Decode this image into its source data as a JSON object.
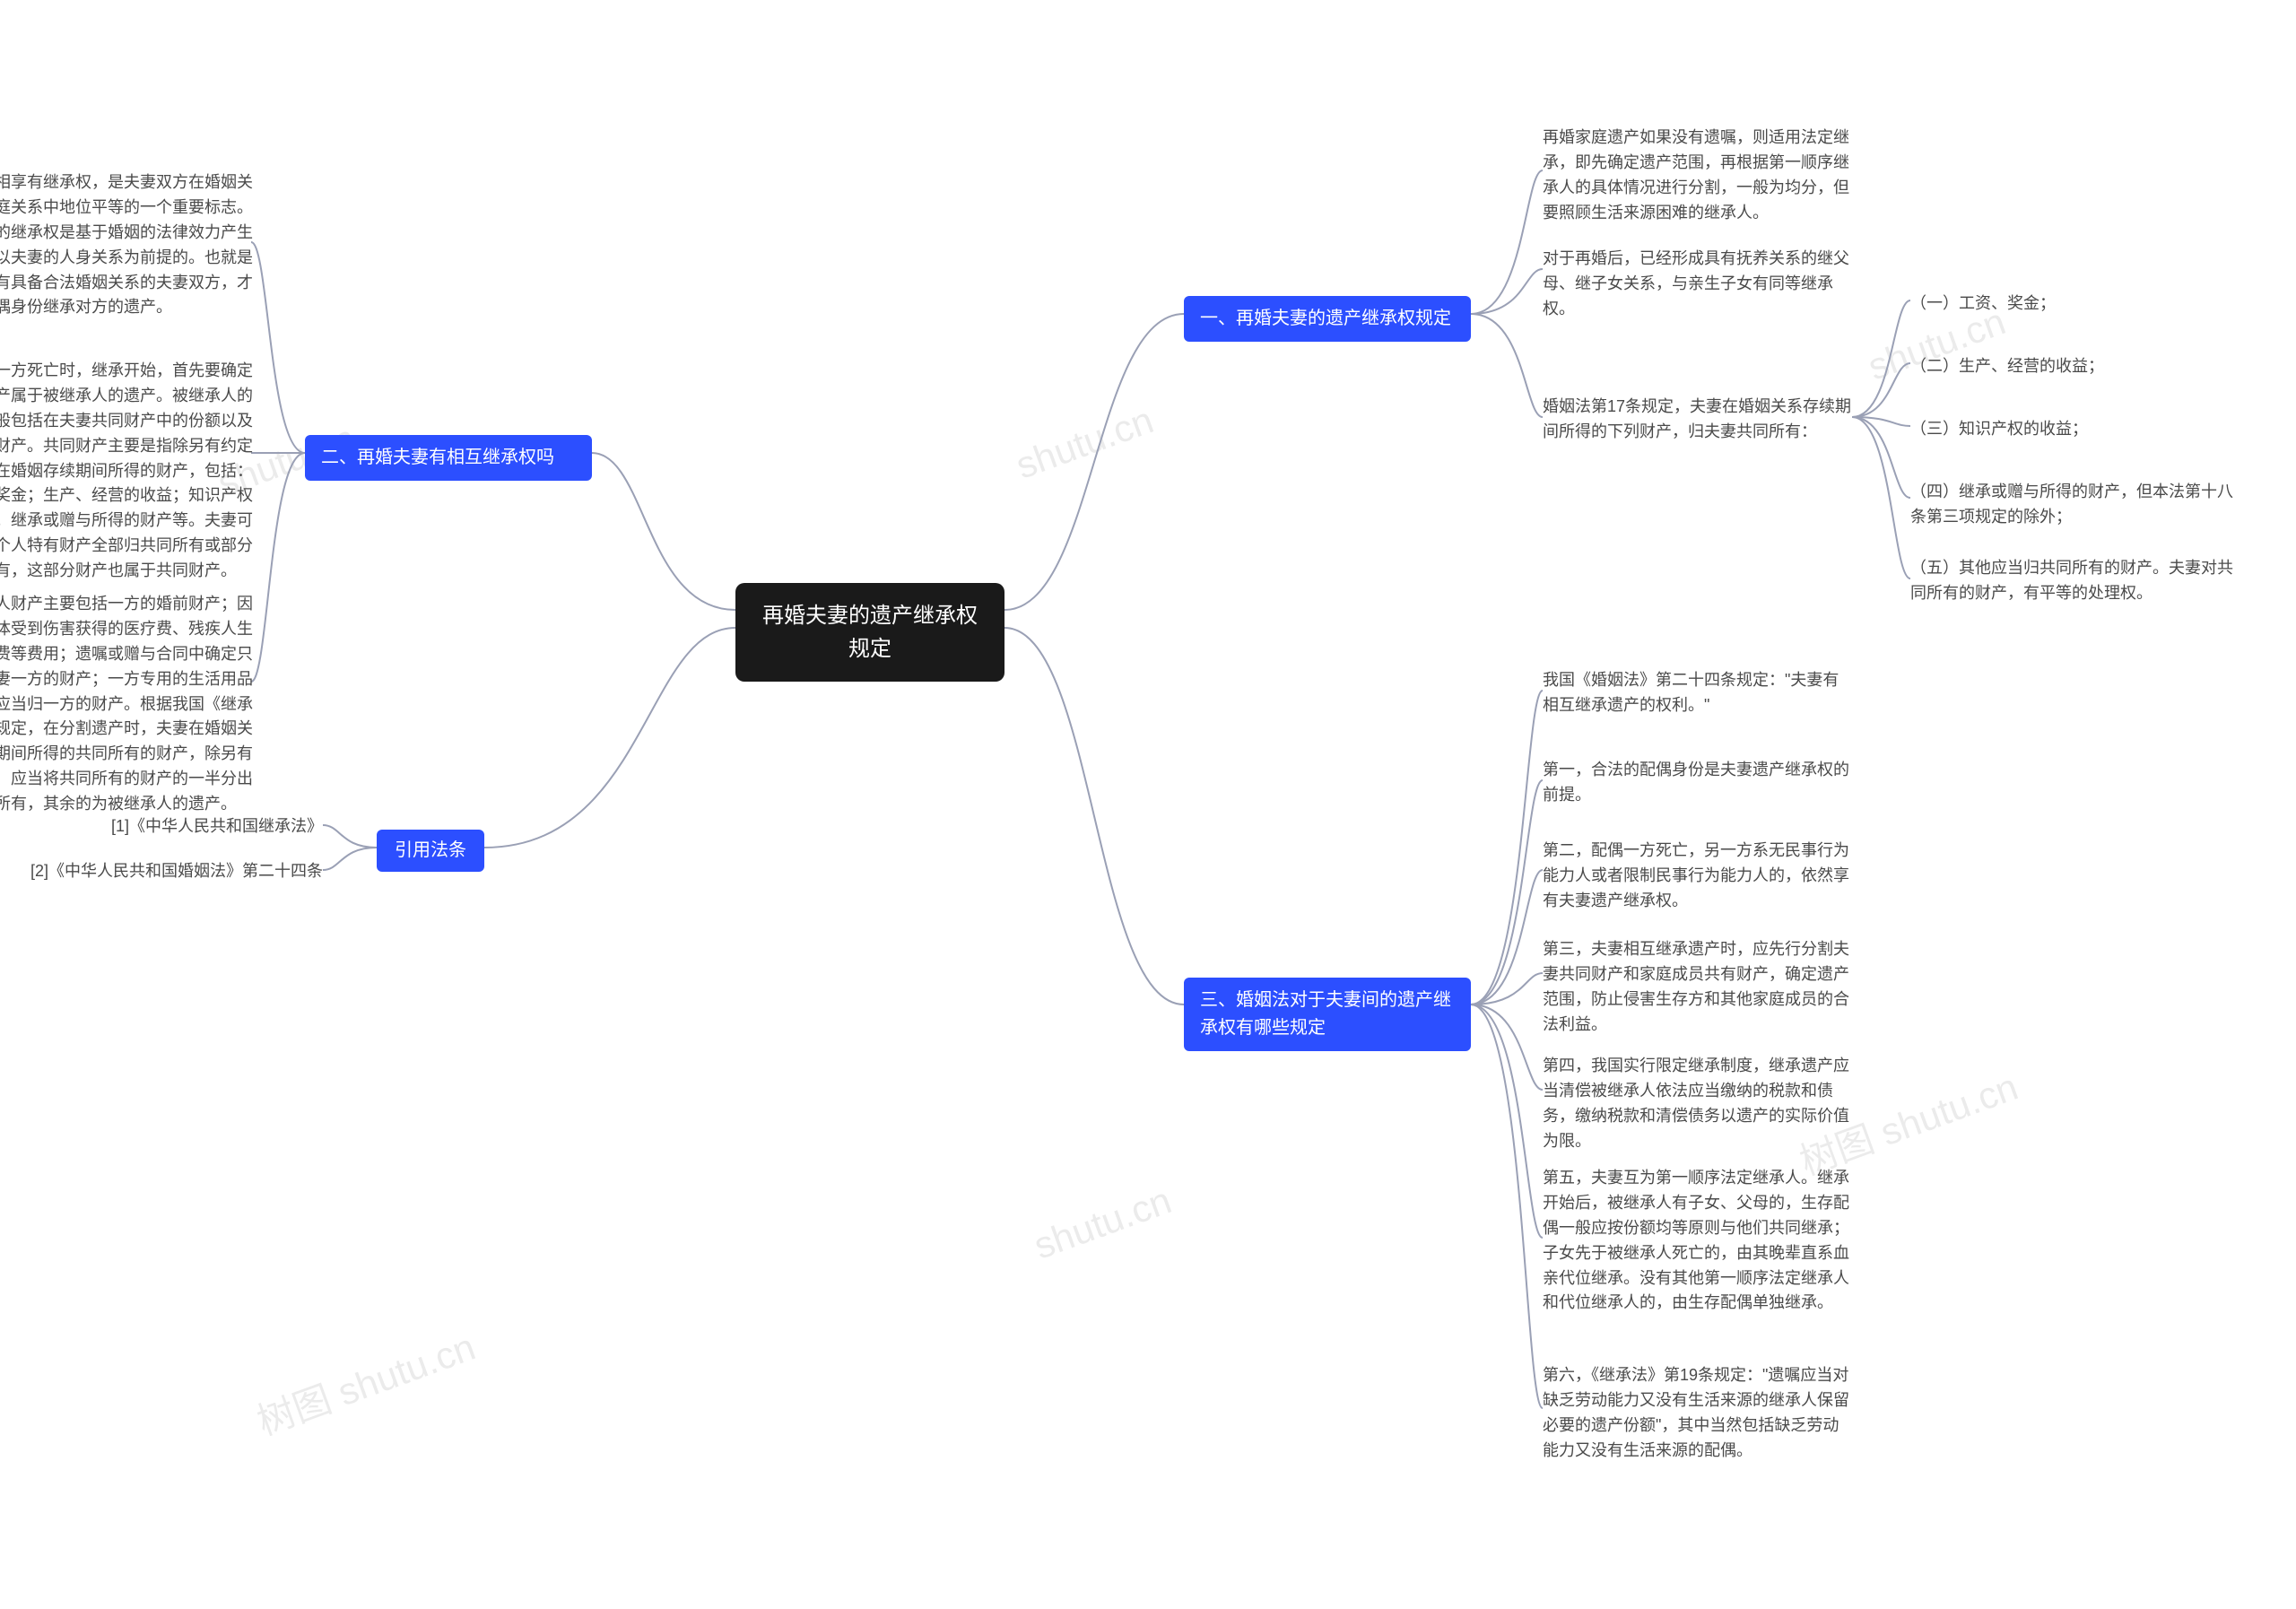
{
  "watermarks": [
    "树图 shutu.cn",
    "shutu.cn",
    "树图 shutu.cn",
    "shutu.cn",
    "树图 shutu.cn"
  ],
  "root": "再婚夫妻的遗产继承权规定",
  "branch_r1": {
    "title": "一、再婚夫妻的遗产继承权规定",
    "leaf1": "再婚家庭遗产如果没有遗嘱，则适用法定继承，即先确定遗产范围，再根据第一顺序继承人的具体情况进行分割，一般为均分，但要照顾生活来源困难的继承人。",
    "leaf2": "对于再婚后，已经形成具有抚养关系的继父母、继子女关系，与亲生子女有同等继承权。",
    "leaf3": "婚姻法第17条规定，夫妻在婚姻关系存续期间所得的下列财产，归夫妻共同所有：",
    "sub": {
      "s1": "（一）工资、奖金；",
      "s2": "（二）生产、经营的收益；",
      "s3": "（三）知识产权的收益；",
      "s4": "（四）继承或赠与所得的财产，但本法第十八条第三项规定的除外；",
      "s5": "（五）其他应当归共同所有的财产。夫妻对共同所有的财产，有平等的处理权。"
    }
  },
  "branch_r2": {
    "title": "三、婚姻法对于夫妻间的遗产继承权有哪些规定",
    "leaf1": "我国《婚姻法》第二十四条规定：\"夫妻有相互继承遗产的权利。\"",
    "leaf2": "第一，合法的配偶身份是夫妻遗产继承权的前提。",
    "leaf3": "第二，配偶一方死亡，另一方系无民事行为能力人或者限制民事行为能力人的，依然享有夫妻遗产继承权。",
    "leaf4": "第三，夫妻相互继承遗产时，应先行分割夫妻共同财产和家庭成员共有财产，确定遗产范围，防止侵害生存方和其他家庭成员的合法利益。",
    "leaf5": "第四，我国实行限定继承制度，继承遗产应当清偿被继承人依法应当缴纳的税款和债务，缴纳税款和清偿债务以遗产的实际价值为限。",
    "leaf6": "第五，夫妻互为第一顺序法定继承人。继承开始后，被继承人有子女、父母的，生存配偶一般应按份额均等原则与他们共同继承；子女先于被继承人死亡的，由其晚辈直系血亲代位继承。没有其他第一顺序法定继承人和代位继承人的，由生存配偶单独继承。",
    "leaf7": "第六，《继承法》第19条规定：\"遗嘱应当对缺乏劳动能力又没有生活来源的继承人保留必要的遗产份额\"，其中当然包括缺乏劳动能力又没有生活来源的配偶。"
  },
  "branch_l1": {
    "title": "二、再婚夫妻有相互继承权吗",
    "leaf1": "夫妻互相享有继承权，是夫妻双方在婚姻关系、家庭关系中地位平等的一个重要标志。夫妻间的继承权是基于婚姻的法律效力产生的，是以夫妻的人身关系为前提的。也就是说，只有具备合法婚姻关系的夫妻双方，才能以配偶身份继承对方的遗产。",
    "leaf2": "夫或妻一方死亡时，继承开始，首先要确定哪些财产属于被继承人的遗产。被继承人的财产一般包括在夫妻共同财产中的份额以及其个人财产。共同财产主要是指除另有约定外夫妻在婚姻存续期间所得的财产，包括：工资、奖金；生产、经营的收益；知识产权的收益；继承或赠与所得的财产等。夫妻可约定其个人特有财产全部归共同所有或部分共同所有，这部分财产也属于共同财产。",
    "leaf3": "夫妻个人财产主要包括一方的婚前财产；因一方身体受到伤害获得的医疗费、残疾人生活补助费等费用；遗嘱或赠与合同中确定只归夫或妻一方的财产；一方专用的生活用品和其他应当归一方的财产。根据我国《继承法》的规定，在分割遗产时，夫妻在婚姻关系存续期间所得的共同所有的财产，除另有约定外，应当将共同所有的财产的一半分出为配偶所有，其余的为被继承人的遗产。"
  },
  "branch_l2": {
    "title": "引用法条",
    "leaf1": "[1]《中华人民共和国继承法》",
    "leaf2": "[2]《中华人民共和国婚姻法》第二十四条"
  }
}
